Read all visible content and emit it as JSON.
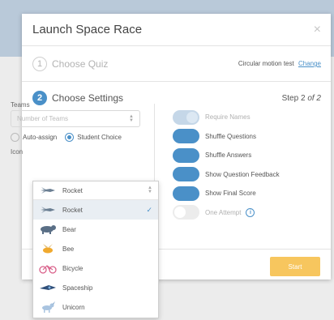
{
  "modal": {
    "title": "Launch Space Race",
    "close_glyph": "×"
  },
  "step1": {
    "number": "1",
    "label": "Choose Quiz",
    "quiz_name": "Circular motion test",
    "change_link": "Change"
  },
  "step2": {
    "number": "2",
    "label": "Choose Settings",
    "progress_prefix": "Step 2",
    "progress_suffix": "of 2"
  },
  "teams": {
    "label": "Teams",
    "placeholder": "Number of Teams",
    "options": [
      {
        "label": "Auto-assign",
        "checked": false
      },
      {
        "label": "Student Choice",
        "checked": true
      }
    ]
  },
  "icon": {
    "label": "Icon",
    "selected": "Rocket",
    "options": [
      {
        "label": "Rocket",
        "icon": "rocket-icon",
        "selected": true
      },
      {
        "label": "Bear",
        "icon": "bear-icon",
        "selected": false
      },
      {
        "label": "Bee",
        "icon": "bee-icon",
        "selected": false
      },
      {
        "label": "Bicycle",
        "icon": "bicycle-icon",
        "selected": false
      },
      {
        "label": "Spaceship",
        "icon": "spaceship-icon",
        "selected": false
      },
      {
        "label": "Unicorn",
        "icon": "unicorn-icon",
        "selected": false
      }
    ],
    "check_glyph": "✓"
  },
  "settings": [
    {
      "label": "Require Names",
      "state": "disabled"
    },
    {
      "label": "Shuffle Questions",
      "state": "on"
    },
    {
      "label": "Shuffle Answers",
      "state": "on"
    },
    {
      "label": "Show Question Feedback",
      "state": "on"
    },
    {
      "label": "Show Final Score",
      "state": "on"
    },
    {
      "label": "One Attempt",
      "state": "off"
    }
  ],
  "info_glyph": "i",
  "start_button": "Start",
  "colors": {
    "accent": "#4a90c8",
    "start": "#f7c65e"
  }
}
